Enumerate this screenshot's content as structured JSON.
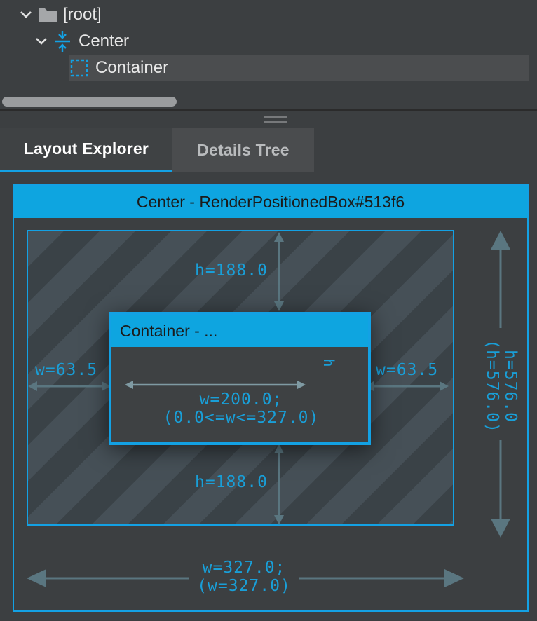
{
  "tree": {
    "items": [
      {
        "label": "[root]",
        "icon": "folder-icon",
        "expanded": true
      },
      {
        "label": "Center",
        "icon": "center-widget-icon",
        "expanded": true
      },
      {
        "label": "Container",
        "icon": "container-widget-icon",
        "selected": true
      }
    ]
  },
  "tabs": [
    {
      "label": "Layout Explorer",
      "active": true
    },
    {
      "label": "Details Tree",
      "active": false
    }
  ],
  "explorer": {
    "parent_title": "Center - RenderPositionedBox#513f6",
    "child_title": "Container - ...",
    "top_space": "h=188.0",
    "bottom_space": "h=188.0",
    "left_space": "w=63.5",
    "right_space": "w=63.5",
    "child_width": "w=200.0;",
    "child_width_constraint": "(0.0<=w<=327.0)",
    "child_height_fragment": "h",
    "parent_height": "h=576.0",
    "parent_height_constraint": "(h=576.0)",
    "parent_width": "w=327.0;",
    "parent_width_constraint": "(w=327.0)"
  },
  "colors": {
    "accent": "#13a1e4",
    "header_blue": "#0ea5e0",
    "arrow": "#5a7680",
    "background": "#3c3f41"
  }
}
